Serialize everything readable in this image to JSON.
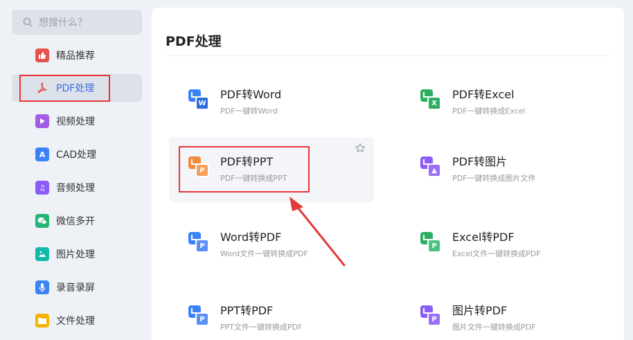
{
  "search": {
    "placeholder": "想搜什么？"
  },
  "sidebar": {
    "items": [
      {
        "label": "精品推荐",
        "icon": "thumbs-up-icon",
        "color": "#e8534f"
      },
      {
        "label": "PDF处理",
        "icon": "pdf-icon",
        "color": "#e8534f",
        "active": true
      },
      {
        "label": "视频处理",
        "icon": "play-icon",
        "color": "#a35ce6"
      },
      {
        "label": "CAD处理",
        "icon": "cad-icon",
        "color": "#3b82f6"
      },
      {
        "label": "音频处理",
        "icon": "music-note-icon",
        "color": "#8b5cf6"
      },
      {
        "label": "微信多开",
        "icon": "wechat-icon",
        "color": "#22b573"
      },
      {
        "label": "图片处理",
        "icon": "image-icon",
        "color": "#14b8a6"
      },
      {
        "label": "录音录屏",
        "icon": "microphone-icon",
        "color": "#3b82f6"
      },
      {
        "label": "文件处理",
        "icon": "folder-icon",
        "color": "#f5b400"
      }
    ]
  },
  "main": {
    "title": "PDF处理",
    "tools": [
      {
        "title": "PDF转Word",
        "subtitle": "PDF一键转Word",
        "badge": "W",
        "from": "#3b82f6",
        "to": "#2d6de0"
      },
      {
        "title": "PDF转Excel",
        "subtitle": "PDF一键转换成Excel",
        "badge": "X",
        "from": "#3b82f6",
        "to": "#2fae63"
      },
      {
        "title": "PDF转PPT",
        "subtitle": "PDF一键转换成PPT",
        "badge": "P",
        "from": "#3b82f6",
        "to": "#f08a3c"
      },
      {
        "title": "PDF转图片",
        "subtitle": "PDF一键转换成图片文件",
        "badge": "▲",
        "from": "#3b82f6",
        "to": "#8b5cf6"
      },
      {
        "title": "Word转PDF",
        "subtitle": "Word文件一键转换成PDF",
        "badge": "P",
        "from": "#3b82f6",
        "to": "#3b82f6"
      },
      {
        "title": "Excel转PDF",
        "subtitle": "Excel文件一键转换成PDF",
        "badge": "P",
        "from": "#2fae63",
        "to": "#2fae63"
      },
      {
        "title": "PPT转PDF",
        "subtitle": "PPT文件一键转换成PDF",
        "badge": "P",
        "from": "#3b82f6",
        "to": "#3b82f6"
      },
      {
        "title": "图片转PDF",
        "subtitle": "图片文件一键转换成PDF",
        "badge": "P",
        "from": "#8b5cf6",
        "to": "#8b5cf6"
      }
    ]
  },
  "colors": {
    "accent": "#3a6fe0",
    "highlight": "#e3373a",
    "ppt_orange": "#f08a3c"
  }
}
